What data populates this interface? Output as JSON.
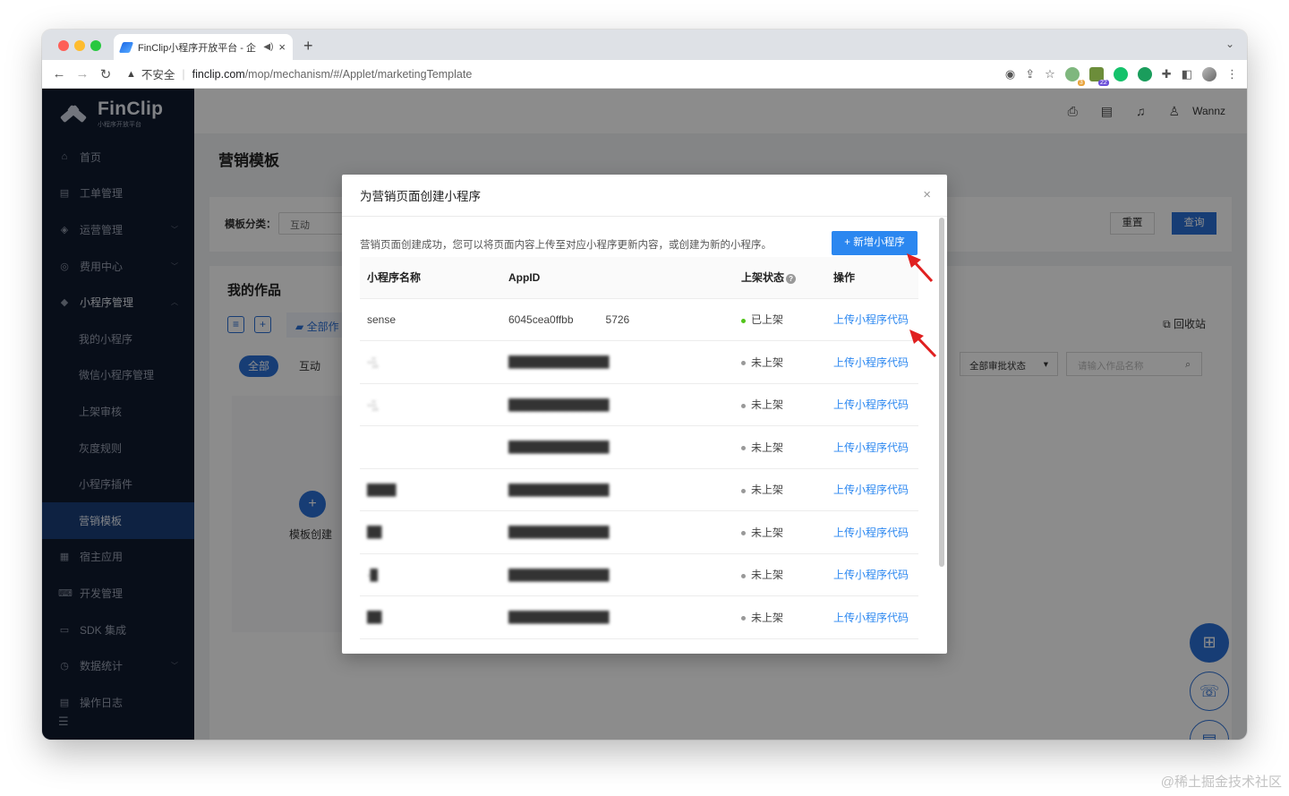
{
  "browser": {
    "tab_title": "FinClip小程序开放平台 - 企",
    "url_warning": "不安全",
    "url_host": "finclip.com",
    "url_path": "/mop/mechanism/#/Applet/marketingTemplate",
    "ext_badge_1": "3",
    "ext_badge_2": "22"
  },
  "sidebar": {
    "brand": "FinClip",
    "brand_sub": "小程序开放平台",
    "items": [
      {
        "label": "首页",
        "icon": "⌂"
      },
      {
        "label": "工单管理",
        "icon": "▤"
      },
      {
        "label": "运营管理",
        "icon": "◈"
      },
      {
        "label": "费用中心",
        "icon": "◎"
      },
      {
        "label": "小程序管理",
        "icon": "◆"
      },
      {
        "label": "我的小程序"
      },
      {
        "label": "微信小程序管理"
      },
      {
        "label": "上架审核"
      },
      {
        "label": "灰度规则"
      },
      {
        "label": "小程序插件"
      },
      {
        "label": "营销模板"
      },
      {
        "label": "宿主应用",
        "icon": "▦"
      },
      {
        "label": "开发管理",
        "icon": "⌨"
      },
      {
        "label": "SDK 集成",
        "icon": "▭"
      },
      {
        "label": "数据统计",
        "icon": "◷"
      },
      {
        "label": "操作日志",
        "icon": "▤"
      }
    ]
  },
  "header": {
    "user": "Wannz"
  },
  "page": {
    "title": "营销模板",
    "filter_label": "模板分类：",
    "filter_value": "互动",
    "reset": "重置",
    "query": "查询",
    "works_title": "我的作品",
    "folder": "全部作",
    "pill_all": "全部",
    "pill_interactive": "互动",
    "recycle": "回收站",
    "status_filter": "全部审批状态",
    "search_placeholder": "请输入作品名称",
    "create_template": "模板创建"
  },
  "modal": {
    "title": "为营销页面创建小程序",
    "description": "营销页面创建成功，您可以将页面内容上传至对应小程序更新内容，或创建为新的小程序。",
    "add_button": "+ 新增小程序",
    "columns": {
      "name": "小程序名称",
      "appid": "AppID",
      "status": "上架状态",
      "action": "操作"
    },
    "rows": [
      {
        "name": "sense",
        "appid": "6045cea0ffbb      5726",
        "status": "已上架",
        "status_color": "#52c41a",
        "action": "上传小程序代码"
      },
      {
        "name": "··̗̈·͕",
        "appid": "██████████████",
        "status": "未上架",
        "status_color": "#999999",
        "action": "上传小程序代码"
      },
      {
        "name": "··̗̈·͕",
        "appid": "██████████████",
        "status": "未上架",
        "status_color": "#999999",
        "action": "上传小程序代码"
      },
      {
        "name": "",
        "appid": "██████████████",
        "status": "未上架",
        "status_color": "#999999",
        "action": "上传小程序代码"
      },
      {
        "name": "████",
        "appid": "██████████████",
        "status": "未上架",
        "status_color": "#999999",
        "action": "上传小程序代码"
      },
      {
        "name": "██",
        "appid": "██████████████",
        "status": "未上架",
        "status_color": "#999999",
        "action": "上传小程序代码"
      },
      {
        "name": "·█",
        "appid": "██████████████",
        "status": "未上架",
        "status_color": "#999999",
        "action": "上传小程序代码"
      },
      {
        "name": "██",
        "appid": "██████████████",
        "status": "未上架",
        "status_color": "#999999",
        "action": "上传小程序代码"
      }
    ]
  },
  "watermark": "@稀土掘金技术社区",
  "colors": {
    "accent": "#2b87f0",
    "sidebar_bg": "#101a2e",
    "sidebar_active": "#1b3f78",
    "annotation_arrow": "#e02020"
  }
}
